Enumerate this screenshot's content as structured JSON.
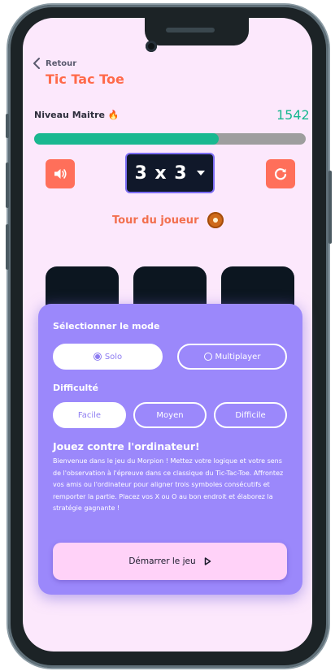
{
  "header": {
    "back_label": "Retour",
    "title": "Tic Tac Toe"
  },
  "status": {
    "level_label": "Niveau Maitre 🔥",
    "score": "1542",
    "progress_fraction": 0.68
  },
  "controls": {
    "grid_size": "3 x 3",
    "sound_icon": "speaker-icon",
    "reset_icon": "refresh-icon"
  },
  "turn": {
    "label": "Tour du joueur"
  },
  "panel": {
    "mode_heading": "Sélectionner le mode",
    "modes": [
      {
        "label": "Solo",
        "selected": true
      },
      {
        "label": "Multiplayer",
        "selected": false
      }
    ],
    "difficulty_heading": "Difficulté",
    "difficulties": [
      {
        "label": "Facile",
        "selected": true
      },
      {
        "label": "Moyen",
        "selected": false
      },
      {
        "label": "Difficile",
        "selected": false
      }
    ],
    "intro_title": "Jouez contre l'ordinateur!",
    "intro_text": "Bienvenue dans le jeu du Morpion ! Mettez votre logique et votre sens de l'observation à l'épreuve dans ce classique du Tic-Tac-Toe. Affrontez vos amis ou l'ordinateur pour aligner trois symboles consécutifs et remporter la partie. Placez vos X ou O au bon endroit et élaborez la stratégie gagnante !",
    "start_label": "Démarrer le jeu"
  },
  "colors": {
    "accent": "#ff6a4a",
    "progress": "#19b890",
    "panel": "#9b88fb",
    "screen_bg": "#fce8fc"
  }
}
